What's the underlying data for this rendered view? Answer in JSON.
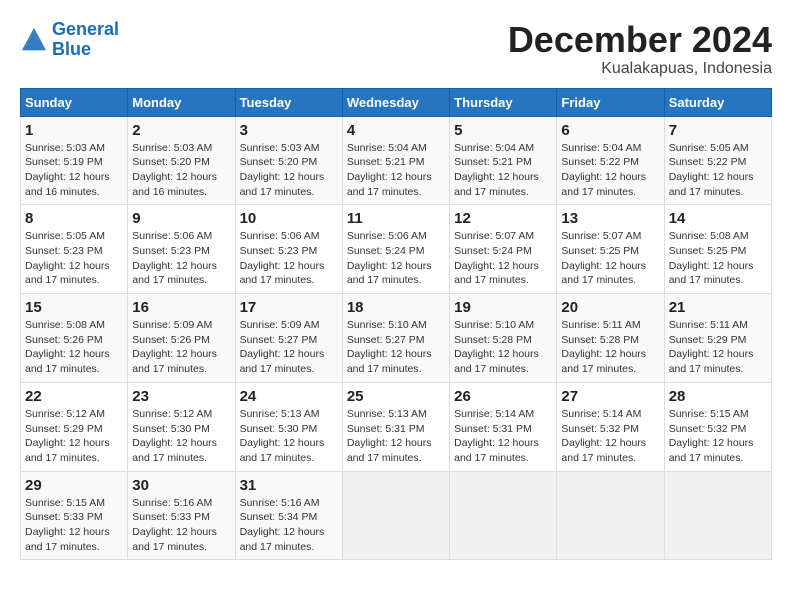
{
  "header": {
    "logo_line1": "General",
    "logo_line2": "Blue",
    "month_title": "December 2024",
    "subtitle": "Kualakapuas, Indonesia"
  },
  "weekdays": [
    "Sunday",
    "Monday",
    "Tuesday",
    "Wednesday",
    "Thursday",
    "Friday",
    "Saturday"
  ],
  "weeks": [
    [
      {
        "day": "1",
        "sunrise": "5:03 AM",
        "sunset": "5:19 PM",
        "daylight": "12 hours and 16 minutes."
      },
      {
        "day": "2",
        "sunrise": "5:03 AM",
        "sunset": "5:20 PM",
        "daylight": "12 hours and 16 minutes."
      },
      {
        "day": "3",
        "sunrise": "5:03 AM",
        "sunset": "5:20 PM",
        "daylight": "12 hours and 17 minutes."
      },
      {
        "day": "4",
        "sunrise": "5:04 AM",
        "sunset": "5:21 PM",
        "daylight": "12 hours and 17 minutes."
      },
      {
        "day": "5",
        "sunrise": "5:04 AM",
        "sunset": "5:21 PM",
        "daylight": "12 hours and 17 minutes."
      },
      {
        "day": "6",
        "sunrise": "5:04 AM",
        "sunset": "5:22 PM",
        "daylight": "12 hours and 17 minutes."
      },
      {
        "day": "7",
        "sunrise": "5:05 AM",
        "sunset": "5:22 PM",
        "daylight": "12 hours and 17 minutes."
      }
    ],
    [
      {
        "day": "8",
        "sunrise": "5:05 AM",
        "sunset": "5:23 PM",
        "daylight": "12 hours and 17 minutes."
      },
      {
        "day": "9",
        "sunrise": "5:06 AM",
        "sunset": "5:23 PM",
        "daylight": "12 hours and 17 minutes."
      },
      {
        "day": "10",
        "sunrise": "5:06 AM",
        "sunset": "5:23 PM",
        "daylight": "12 hours and 17 minutes."
      },
      {
        "day": "11",
        "sunrise": "5:06 AM",
        "sunset": "5:24 PM",
        "daylight": "12 hours and 17 minutes."
      },
      {
        "day": "12",
        "sunrise": "5:07 AM",
        "sunset": "5:24 PM",
        "daylight": "12 hours and 17 minutes."
      },
      {
        "day": "13",
        "sunrise": "5:07 AM",
        "sunset": "5:25 PM",
        "daylight": "12 hours and 17 minutes."
      },
      {
        "day": "14",
        "sunrise": "5:08 AM",
        "sunset": "5:25 PM",
        "daylight": "12 hours and 17 minutes."
      }
    ],
    [
      {
        "day": "15",
        "sunrise": "5:08 AM",
        "sunset": "5:26 PM",
        "daylight": "12 hours and 17 minutes."
      },
      {
        "day": "16",
        "sunrise": "5:09 AM",
        "sunset": "5:26 PM",
        "daylight": "12 hours and 17 minutes."
      },
      {
        "day": "17",
        "sunrise": "5:09 AM",
        "sunset": "5:27 PM",
        "daylight": "12 hours and 17 minutes."
      },
      {
        "day": "18",
        "sunrise": "5:10 AM",
        "sunset": "5:27 PM",
        "daylight": "12 hours and 17 minutes."
      },
      {
        "day": "19",
        "sunrise": "5:10 AM",
        "sunset": "5:28 PM",
        "daylight": "12 hours and 17 minutes."
      },
      {
        "day": "20",
        "sunrise": "5:11 AM",
        "sunset": "5:28 PM",
        "daylight": "12 hours and 17 minutes."
      },
      {
        "day": "21",
        "sunrise": "5:11 AM",
        "sunset": "5:29 PM",
        "daylight": "12 hours and 17 minutes."
      }
    ],
    [
      {
        "day": "22",
        "sunrise": "5:12 AM",
        "sunset": "5:29 PM",
        "daylight": "12 hours and 17 minutes."
      },
      {
        "day": "23",
        "sunrise": "5:12 AM",
        "sunset": "5:30 PM",
        "daylight": "12 hours and 17 minutes."
      },
      {
        "day": "24",
        "sunrise": "5:13 AM",
        "sunset": "5:30 PM",
        "daylight": "12 hours and 17 minutes."
      },
      {
        "day": "25",
        "sunrise": "5:13 AM",
        "sunset": "5:31 PM",
        "daylight": "12 hours and 17 minutes."
      },
      {
        "day": "26",
        "sunrise": "5:14 AM",
        "sunset": "5:31 PM",
        "daylight": "12 hours and 17 minutes."
      },
      {
        "day": "27",
        "sunrise": "5:14 AM",
        "sunset": "5:32 PM",
        "daylight": "12 hours and 17 minutes."
      },
      {
        "day": "28",
        "sunrise": "5:15 AM",
        "sunset": "5:32 PM",
        "daylight": "12 hours and 17 minutes."
      }
    ],
    [
      {
        "day": "29",
        "sunrise": "5:15 AM",
        "sunset": "5:33 PM",
        "daylight": "12 hours and 17 minutes."
      },
      {
        "day": "30",
        "sunrise": "5:16 AM",
        "sunset": "5:33 PM",
        "daylight": "12 hours and 17 minutes."
      },
      {
        "day": "31",
        "sunrise": "5:16 AM",
        "sunset": "5:34 PM",
        "daylight": "12 hours and 17 minutes."
      },
      null,
      null,
      null,
      null
    ]
  ],
  "labels": {
    "sunrise_prefix": "Sunrise: ",
    "sunset_prefix": "Sunset: ",
    "daylight_prefix": "Daylight: "
  }
}
